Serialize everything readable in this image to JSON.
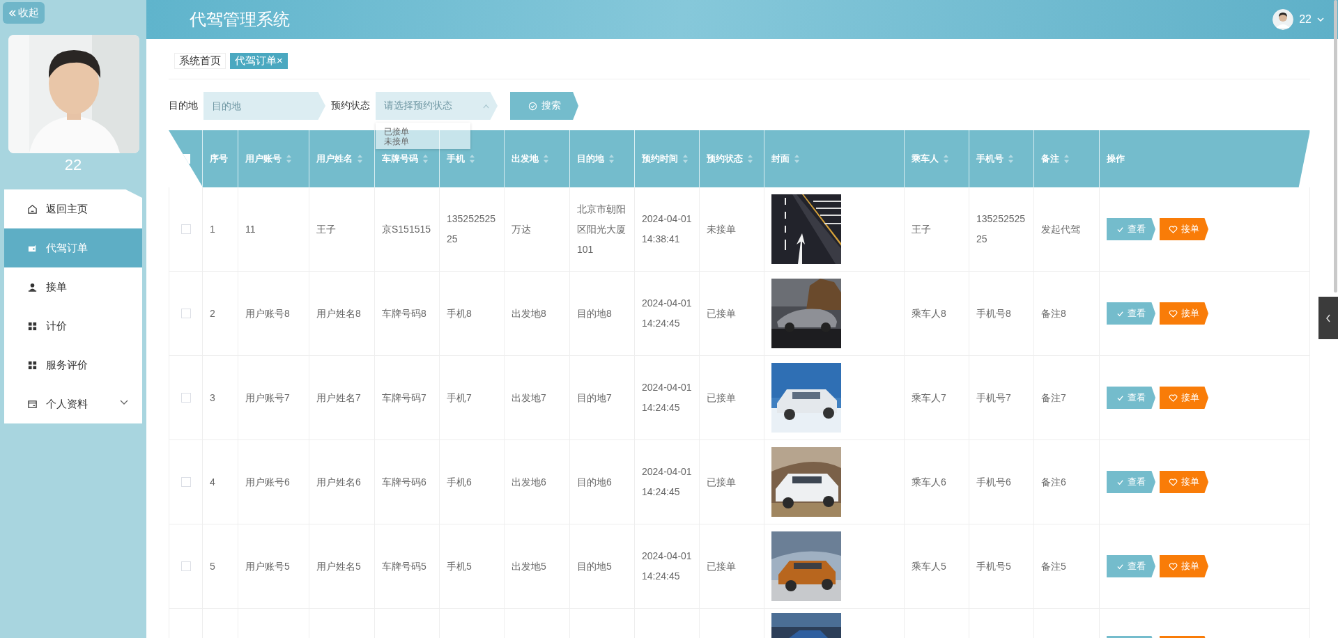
{
  "sidebar": {
    "collapse_button": "收起",
    "user_name": "22",
    "menu": [
      {
        "label": "返回主页",
        "kind": "home",
        "selected": false
      },
      {
        "label": "代驾订单",
        "kind": "wallet",
        "selected": true
      },
      {
        "label": "接单",
        "kind": "user",
        "selected": false
      },
      {
        "label": "计价",
        "kind": "grid",
        "selected": false
      },
      {
        "label": "服务评价",
        "kind": "grid",
        "selected": false
      },
      {
        "label": "个人资料",
        "kind": "card",
        "selected": false,
        "expanded": false
      }
    ]
  },
  "header": {
    "title": "代驾管理系统",
    "user": "22"
  },
  "breadcrumbs": [
    {
      "label": "系统首页",
      "selected": false
    },
    {
      "label": "代驾订单",
      "selected": true,
      "close": "×"
    }
  ],
  "search": {
    "fields": [
      {
        "kind": "input",
        "label": "目的地",
        "placeholder": "目的地"
      },
      {
        "kind": "select",
        "label": "预约状态",
        "placeholder": "请选择预约状态",
        "expanded": true,
        "options": [
          "已接单",
          "未接单"
        ]
      }
    ],
    "button": "搜索"
  },
  "table": {
    "select_all": {
      "checked": false
    },
    "columns": [
      {
        "label": "序号",
        "kind": "text",
        "sortable": false
      },
      {
        "label": "用户账号",
        "kind": "text",
        "sortable": true
      },
      {
        "label": "用户姓名",
        "kind": "text",
        "sortable": true
      },
      {
        "label": "车牌号码",
        "kind": "text",
        "sortable": true
      },
      {
        "label": "手机",
        "kind": "text",
        "sortable": true
      },
      {
        "label": "出发地",
        "kind": "text",
        "sortable": true
      },
      {
        "label": "目的地",
        "kind": "text",
        "sortable": true
      },
      {
        "label": "预约时间",
        "kind": "text",
        "sortable": true
      },
      {
        "label": "预约状态",
        "kind": "text",
        "sortable": true
      },
      {
        "label": "封面",
        "kind": "picture",
        "sortable": true
      },
      {
        "label": "乘车人",
        "kind": "text",
        "sortable": true
      },
      {
        "label": "手机号",
        "kind": "text",
        "sortable": true
      },
      {
        "label": "备注",
        "kind": "text",
        "sortable": true
      },
      {
        "label": "操作",
        "kind": "actions",
        "sortable": false
      }
    ],
    "rows": [
      {
        "kind": "full",
        "checked": false,
        "cells": [
          "1",
          "11",
          "王子",
          "京S151515",
          "13525252525",
          "万达",
          "北京市朝阳区阳光大厦101",
          "2024-04-01 14:38:41",
          "未接单",
          "王子",
          "13525252525",
          "发起代驾"
        ],
        "actions": [
          {
            "kind": "view",
            "label": "查看"
          },
          {
            "kind": "accept",
            "label": "接单"
          }
        ]
      },
      {
        "kind": "full",
        "checked": false,
        "cells": [
          "2",
          "用户账号8",
          "用户姓名8",
          "车牌号码8",
          "手机8",
          "出发地8",
          "目的地8",
          "2024-04-01 14:24:45",
          "已接单",
          "乘车人8",
          "手机号8",
          "备注8"
        ],
        "actions": [
          {
            "kind": "view",
            "label": "查看"
          },
          {
            "kind": "accept",
            "label": "接单"
          }
        ]
      },
      {
        "kind": "full",
        "checked": false,
        "cells": [
          "3",
          "用户账号7",
          "用户姓名7",
          "车牌号码7",
          "手机7",
          "出发地7",
          "目的地7",
          "2024-04-01 14:24:45",
          "已接单",
          "乘车人7",
          "手机号7",
          "备注7"
        ],
        "actions": [
          {
            "kind": "view",
            "label": "查看"
          },
          {
            "kind": "accept",
            "label": "接单"
          }
        ]
      },
      {
        "kind": "full",
        "checked": false,
        "cells": [
          "4",
          "用户账号6",
          "用户姓名6",
          "车牌号码6",
          "手机6",
          "出发地6",
          "目的地6",
          "2024-04-01 14:24:45",
          "已接单",
          "乘车人6",
          "手机号6",
          "备注6"
        ],
        "actions": [
          {
            "kind": "view",
            "label": "查看"
          },
          {
            "kind": "accept",
            "label": "接单"
          }
        ]
      },
      {
        "kind": "full",
        "checked": false,
        "cells": [
          "5",
          "用户账号5",
          "用户姓名5",
          "车牌号码5",
          "手机5",
          "出发地5",
          "目的地5",
          "2024-04-01 14:24:45",
          "已接单",
          "乘车人5",
          "手机号5",
          "备注5"
        ],
        "actions": [
          {
            "kind": "view",
            "label": "查看"
          },
          {
            "kind": "accept",
            "label": "接单"
          }
        ]
      },
      {
        "kind": "cut",
        "actions": [
          {
            "kind": "view"
          },
          {
            "kind": "accept"
          }
        ]
      }
    ]
  }
}
